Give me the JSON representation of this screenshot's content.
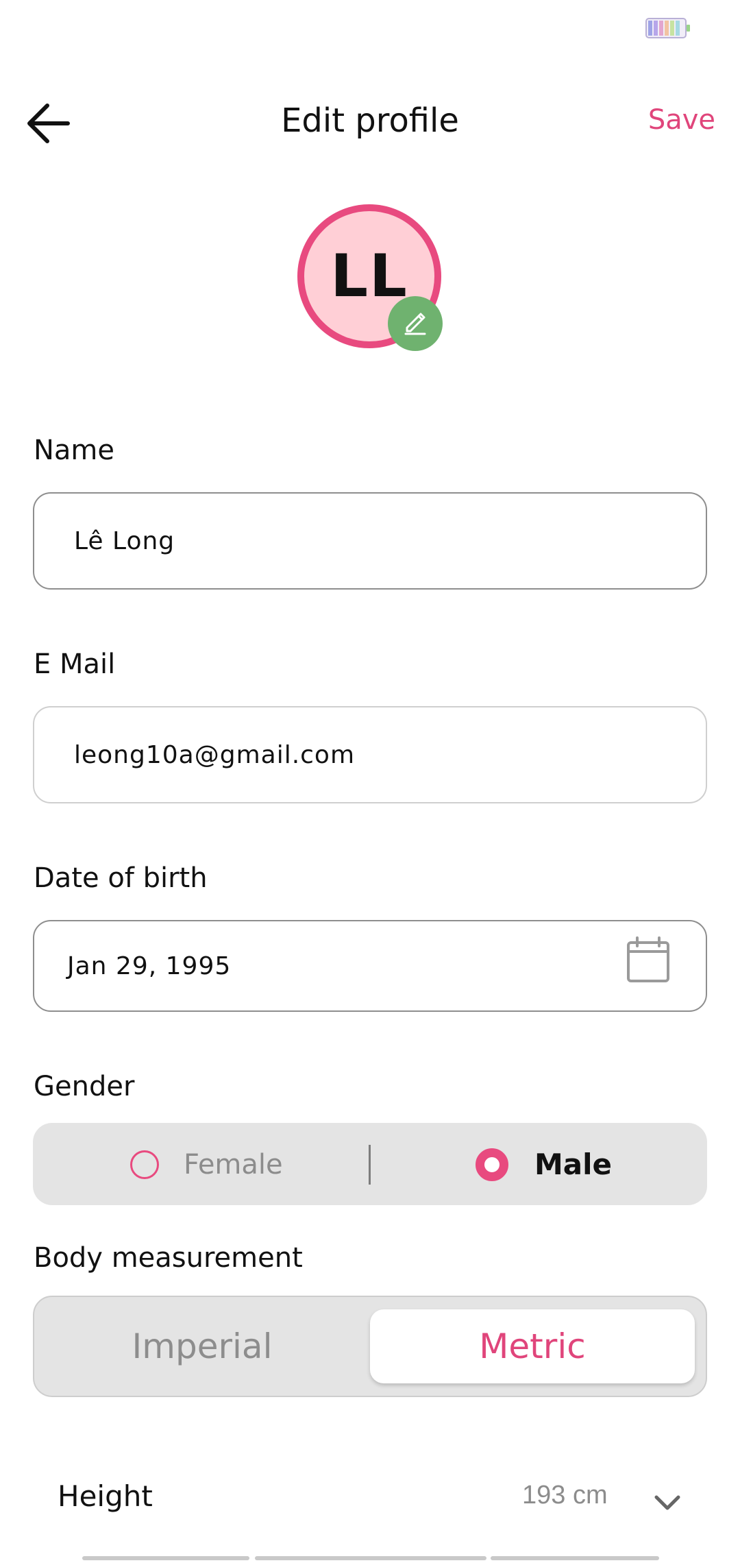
{
  "status_bar": {
    "battery_level": "100",
    "battery_icon": "battery-icon"
  },
  "header": {
    "title": "Edit profile",
    "save_label": "Save",
    "back_icon": "arrow-left-icon"
  },
  "avatar": {
    "initials": "LL",
    "edit_icon": "pencil-icon"
  },
  "form": {
    "name": {
      "label": "Name",
      "value": "Lê Long"
    },
    "email": {
      "label": "E Mail",
      "value": "leong10a@gmail.com"
    },
    "dob": {
      "label": "Date of birth",
      "value": "Jan 29, 1995",
      "icon": "calendar-icon"
    },
    "gender": {
      "label": "Gender",
      "options": [
        "Female",
        "Male"
      ],
      "selected": "Male"
    },
    "body_measurement": {
      "label": "Body measurement",
      "options": [
        "Imperial",
        "Metric"
      ],
      "selected": "Metric"
    },
    "height": {
      "label": "Height",
      "value": "193 cm",
      "icon": "chevron-down-icon"
    }
  },
  "colors": {
    "accent": "#e84a7f",
    "avatar_bg": "#ffcfd6",
    "edit_badge": "#6fb26f",
    "segment_bg": "#e4e4e4"
  }
}
